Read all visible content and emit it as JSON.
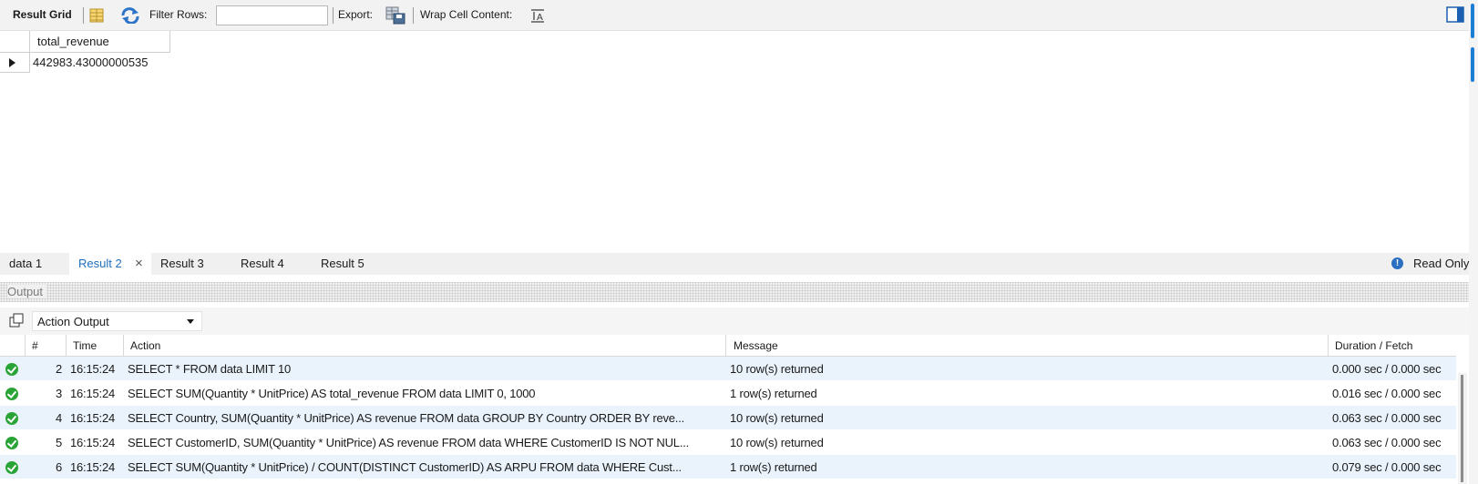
{
  "toolbar": {
    "result_grid_label": "Result Grid",
    "filter_rows_label": "Filter Rows:",
    "filter_rows_value": "",
    "export_label": "Export:",
    "wrap_cell_label": "Wrap Cell Content:",
    "icons": [
      "grid-form-icon",
      "refresh-icon",
      "export-icon",
      "wrap-text-icon",
      "panel-toggle-icon"
    ]
  },
  "result_grid": {
    "columns": [
      "total_revenue"
    ],
    "rows": [
      [
        "442983.43000000535"
      ]
    ]
  },
  "result_tabs": {
    "tabs": [
      {
        "label": "data 1",
        "active": false
      },
      {
        "label": "Result 2",
        "active": true
      },
      {
        "label": "Result 3",
        "active": false
      },
      {
        "label": "Result 4",
        "active": false
      },
      {
        "label": "Result 5",
        "active": false
      }
    ],
    "read_only_label": "Read Only"
  },
  "output": {
    "title": "Output",
    "selector_value": "Action Output",
    "columns": [
      "#",
      "Time",
      "Action",
      "Message",
      "Duration / Fetch"
    ],
    "rows": [
      {
        "num": "2",
        "time": "16:15:24",
        "action": "SELECT *  FROM data LIMIT 10",
        "message": "10 row(s) returned",
        "duration": "0.000 sec / 0.000 sec",
        "status": "success"
      },
      {
        "num": "3",
        "time": "16:15:24",
        "action": "SELECT SUM(Quantity * UnitPrice) AS total_revenue FROM data LIMIT 0, 1000",
        "message": "1 row(s) returned",
        "duration": "0.016 sec / 0.000 sec",
        "status": "success"
      },
      {
        "num": "4",
        "time": "16:15:24",
        "action": "SELECT Country, SUM(Quantity * UnitPrice) AS revenue FROM data GROUP BY Country ORDER BY reve...",
        "message": "10 row(s) returned",
        "duration": "0.063 sec / 0.000 sec",
        "status": "success"
      },
      {
        "num": "5",
        "time": "16:15:24",
        "action": "SELECT CustomerID, SUM(Quantity * UnitPrice) AS revenue FROM data WHERE CustomerID IS NOT NUL...",
        "message": "10 row(s) returned",
        "duration": "0.063 sec / 0.000 sec",
        "status": "success"
      },
      {
        "num": "6",
        "time": "16:15:24",
        "action": "SELECT   SUM(Quantity * UnitPrice) / COUNT(DISTINCT CustomerID) AS ARPU FROM data WHERE Cust...",
        "message": "1 row(s) returned",
        "duration": "0.079 sec / 0.000 sec",
        "status": "success"
      }
    ]
  },
  "colors": {
    "accent": "#1f6fbf",
    "success": "#2aa337",
    "row_alt": "#eaf3fc"
  }
}
